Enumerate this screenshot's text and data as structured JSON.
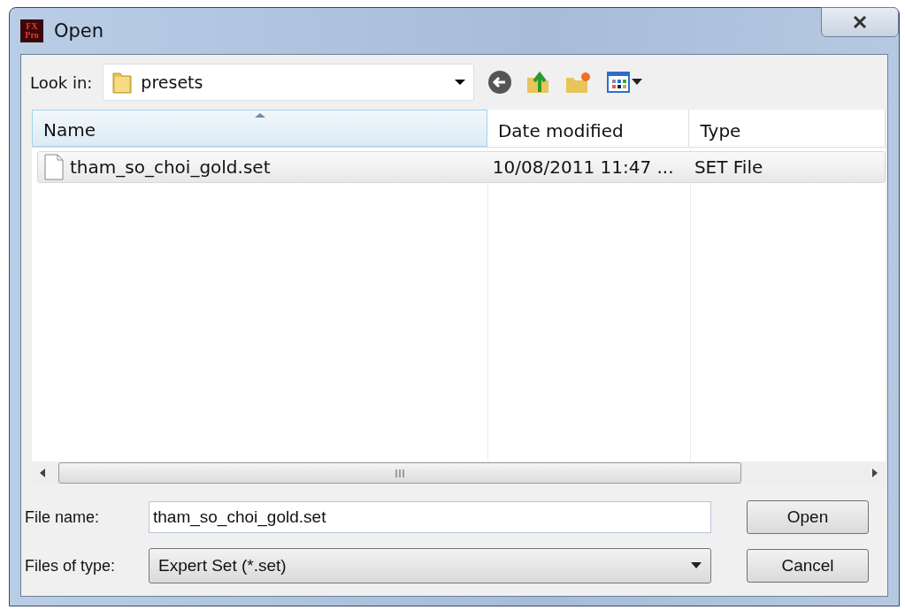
{
  "window": {
    "title": "Open",
    "app_icon": [
      "FX",
      "Pro"
    ]
  },
  "look_in": {
    "label": "Look in:",
    "value": "presets"
  },
  "file_list": {
    "columns": [
      {
        "label": "Name",
        "sorted": true
      },
      {
        "label": "Date modified",
        "sorted": false
      },
      {
        "label": "Type",
        "sorted": false
      }
    ],
    "rows": [
      {
        "name": "tham_so_choi_gold.set",
        "date": "10/08/2011 11:47 ...",
        "type": "SET File",
        "selected": true
      }
    ]
  },
  "file_name": {
    "label": "File name:",
    "value": "tham_so_choi_gold.set"
  },
  "file_type": {
    "label": "Files of type:",
    "value": "Expert Set (*.set)"
  },
  "buttons": [
    "Open",
    "Cancel"
  ]
}
